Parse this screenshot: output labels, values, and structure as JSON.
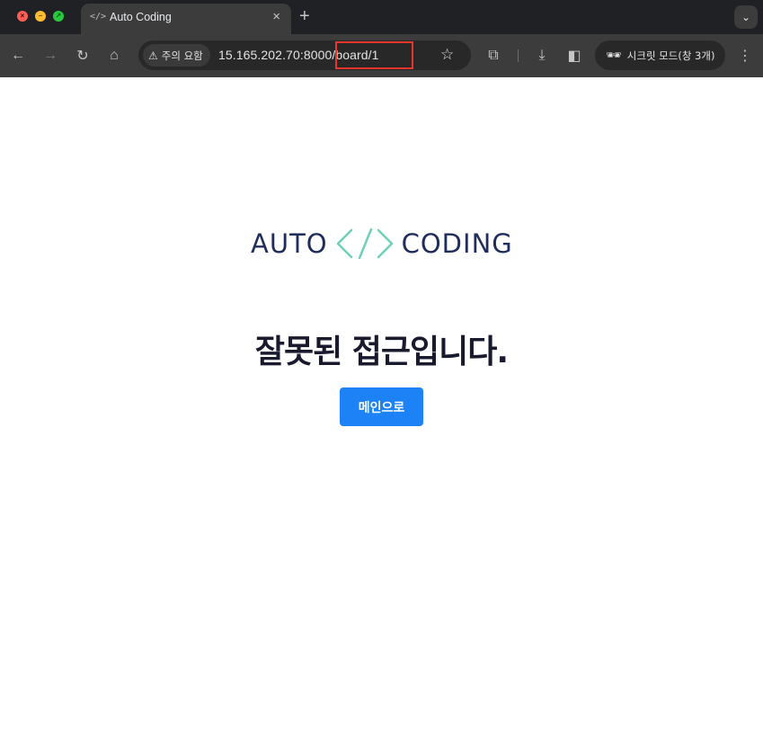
{
  "browser": {
    "tab_title": "Auto Coding",
    "tab_favicon": "</>",
    "new_tab_label": "+",
    "security_label": "주의 요함",
    "url": "15.165.202.70:8000/board/1",
    "incognito_label": "시크릿 모드(창 3개)"
  },
  "page": {
    "logo_left": "AUTO",
    "logo_right": "CODING",
    "heading": "잘못된 접근입니다.",
    "main_button_label": "메인으로"
  },
  "colors": {
    "accent_blue": "#1d82f5",
    "logo_navy": "#1f2d5c",
    "logo_teal": "#6fd0b8",
    "highlight_red": "#e8362b"
  }
}
